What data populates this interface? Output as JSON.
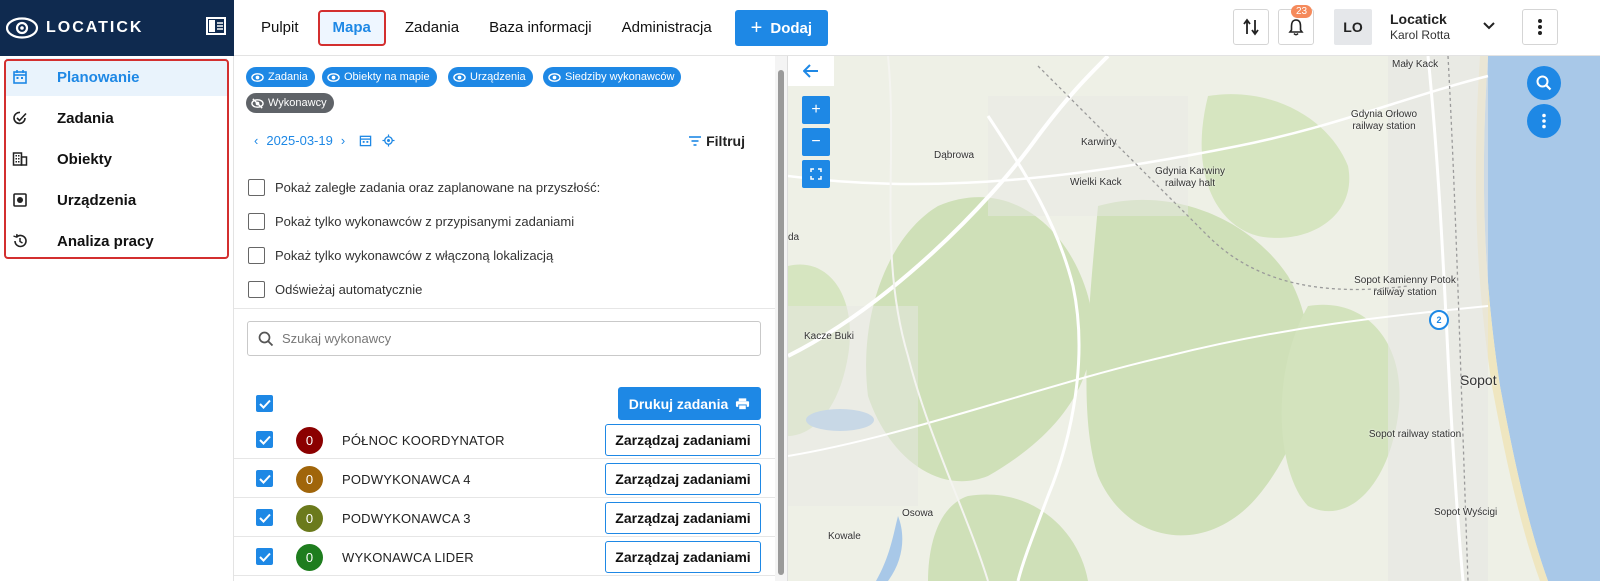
{
  "brand": {
    "name": "LOCATICK"
  },
  "nav": {
    "items": [
      {
        "label": "Pulpit"
      },
      {
        "label": "Mapa",
        "active": true
      },
      {
        "label": "Zadania"
      },
      {
        "label": "Baza informacji"
      },
      {
        "label": "Administracja"
      }
    ],
    "add_label": "Dodaj"
  },
  "header": {
    "notifications_count": "23",
    "avatar_initials": "LO",
    "user_name": "Locatick",
    "user_sub": "Karol Rotta"
  },
  "sidebar": {
    "items": [
      {
        "label": "Planowanie",
        "icon": "calendar-icon",
        "active": true
      },
      {
        "label": "Zadania",
        "icon": "task-check-icon"
      },
      {
        "label": "Obiekty",
        "icon": "building-icon"
      },
      {
        "label": "Urządzenia",
        "icon": "device-icon"
      },
      {
        "label": "Analiza pracy",
        "icon": "history-icon"
      }
    ]
  },
  "panel": {
    "chips": [
      {
        "label": "Zadania",
        "visible": true
      },
      {
        "label": "Obiekty na mapie",
        "visible": true
      },
      {
        "label": "Urządzenia",
        "visible": true
      },
      {
        "label": "Siedziby wykonawców",
        "visible": true
      },
      {
        "label": "Wykonawcy",
        "visible": false
      }
    ],
    "date": "2025-03-19",
    "filter_label": "Filtruj",
    "options": [
      {
        "label": "Pokaż zaległe zadania oraz zaplanowane na przyszłość:",
        "checked": false
      },
      {
        "label": "Pokaż tylko wykonawców z przypisanymi zadaniami",
        "checked": false
      },
      {
        "label": "Pokaż tylko wykonawców z włączoną lokalizacją",
        "checked": false
      },
      {
        "label": "Odświeżaj automatycznie",
        "checked": false
      }
    ],
    "search_placeholder": "Szukaj wykonawcy",
    "print_label": "Drukuj zadania",
    "manage_label": "Zarządzaj zadaniami",
    "rows": [
      {
        "name": "PÓŁNOC KOORDYNATOR",
        "count": "0",
        "color": "#8b0000",
        "checked": true
      },
      {
        "name": "PODWYKONAWCA 4",
        "count": "0",
        "color": "#a0650a",
        "checked": true
      },
      {
        "name": "PODWYKONAWCA 3",
        "count": "0",
        "color": "#6b7a1c",
        "checked": true
      },
      {
        "name": "WYKONAWCA LIDER",
        "count": "0",
        "color": "#1e7d1e",
        "checked": true
      }
    ]
  },
  "map": {
    "labels": [
      {
        "text": "Mały Kack"
      },
      {
        "text": "Dąbrowa"
      },
      {
        "text": "Karwiny"
      },
      {
        "text": "Gdynia Orłowo railway station"
      },
      {
        "text": "Gdynia Karwiny railway halt"
      },
      {
        "text": "Wielki Kack"
      },
      {
        "text": "da"
      },
      {
        "text": "Sopot Kamienny Potok railway station"
      },
      {
        "text": "Kacze Buki"
      },
      {
        "text": "Sopot"
      },
      {
        "text": "Sopot railway station"
      },
      {
        "text": "Osowa"
      },
      {
        "text": "Kowale"
      },
      {
        "text": "Sopot Wyścigi"
      }
    ],
    "marker_count": "2"
  },
  "colors": {
    "accent": "#1e88e5",
    "brand": "#0f2a4f",
    "highlight": "#d32f2f"
  }
}
